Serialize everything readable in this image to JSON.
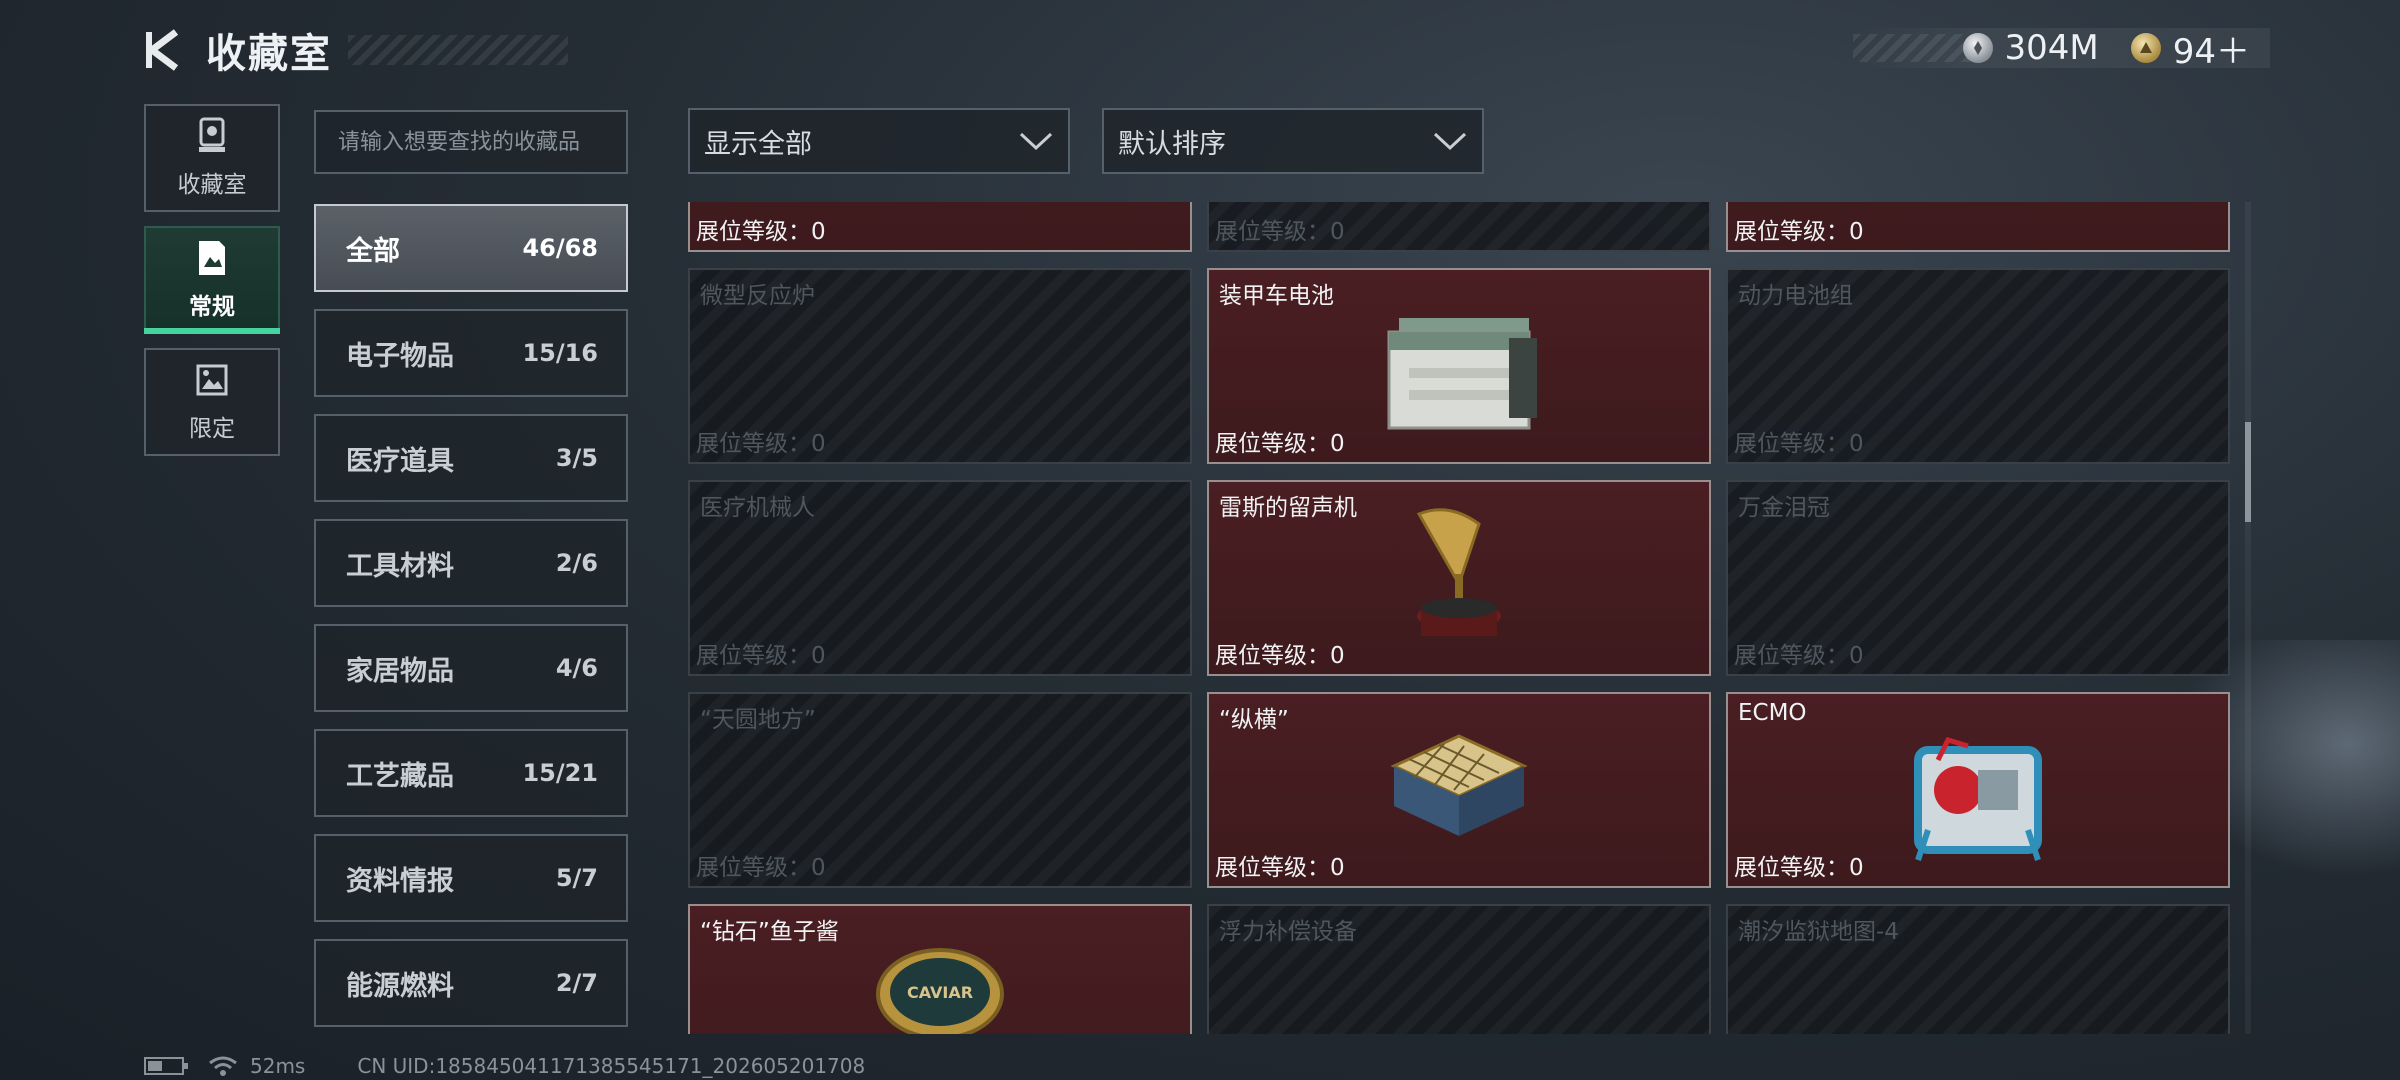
{
  "header": {
    "title": "收藏室"
  },
  "currency": {
    "silver_value": "304M",
    "gold_value": "94＋"
  },
  "leftnav": {
    "items": [
      {
        "label": "收藏室",
        "icon": "trophy-icon"
      },
      {
        "label": "常规",
        "icon": "document-icon",
        "active": true
      },
      {
        "label": "限定",
        "icon": "image-icon"
      }
    ]
  },
  "search": {
    "placeholder": "请输入想要查找的收藏品"
  },
  "categories": [
    {
      "name": "全部",
      "count": "46/68",
      "active": true
    },
    {
      "name": "电子物品",
      "count": "15/16"
    },
    {
      "name": "医疗道具",
      "count": "3/5"
    },
    {
      "name": "工具材料",
      "count": "2/6"
    },
    {
      "name": "家居物品",
      "count": "4/6"
    },
    {
      "name": "工艺藏品",
      "count": "15/21"
    },
    {
      "name": "资料情报",
      "count": "5/7"
    },
    {
      "name": "能源燃料",
      "count": "2/7"
    }
  ],
  "filters": {
    "show": "显示全部",
    "sort": "默认排序"
  },
  "level_label": "展位等级：0",
  "cards": [
    {
      "name": "",
      "owned": true
    },
    {
      "name": "",
      "owned": false
    },
    {
      "name": "",
      "owned": true
    },
    {
      "name": "微型反应炉",
      "owned": false
    },
    {
      "name": "装甲车电池",
      "owned": true,
      "icon": "battery-item-icon"
    },
    {
      "name": "动力电池组",
      "owned": false
    },
    {
      "name": "医疗机械人",
      "owned": false
    },
    {
      "name": "雷斯的留声机",
      "owned": true,
      "icon": "gramophone-icon"
    },
    {
      "name": "万金泪冠",
      "owned": false
    },
    {
      "name": "“天圆地方”",
      "owned": false
    },
    {
      "name": "“纵横”",
      "owned": true,
      "icon": "chessboard-icon"
    },
    {
      "name": "ECMO",
      "owned": true,
      "icon": "ecmo-machine-icon"
    },
    {
      "name": "“钻石”鱼子酱",
      "owned": true,
      "icon": "caviar-tin-icon"
    },
    {
      "name": "浮力补偿设备",
      "owned": false
    },
    {
      "name": "潮汐监狱地图-4",
      "owned": false
    }
  ],
  "caviar_label": "CAVIAR",
  "status": {
    "ping": "52ms",
    "uid": "CN UID:185845041171385545171_202605201708"
  },
  "colors": {
    "accent": "#45d4a0",
    "owned_bg": "#4a1e22"
  }
}
